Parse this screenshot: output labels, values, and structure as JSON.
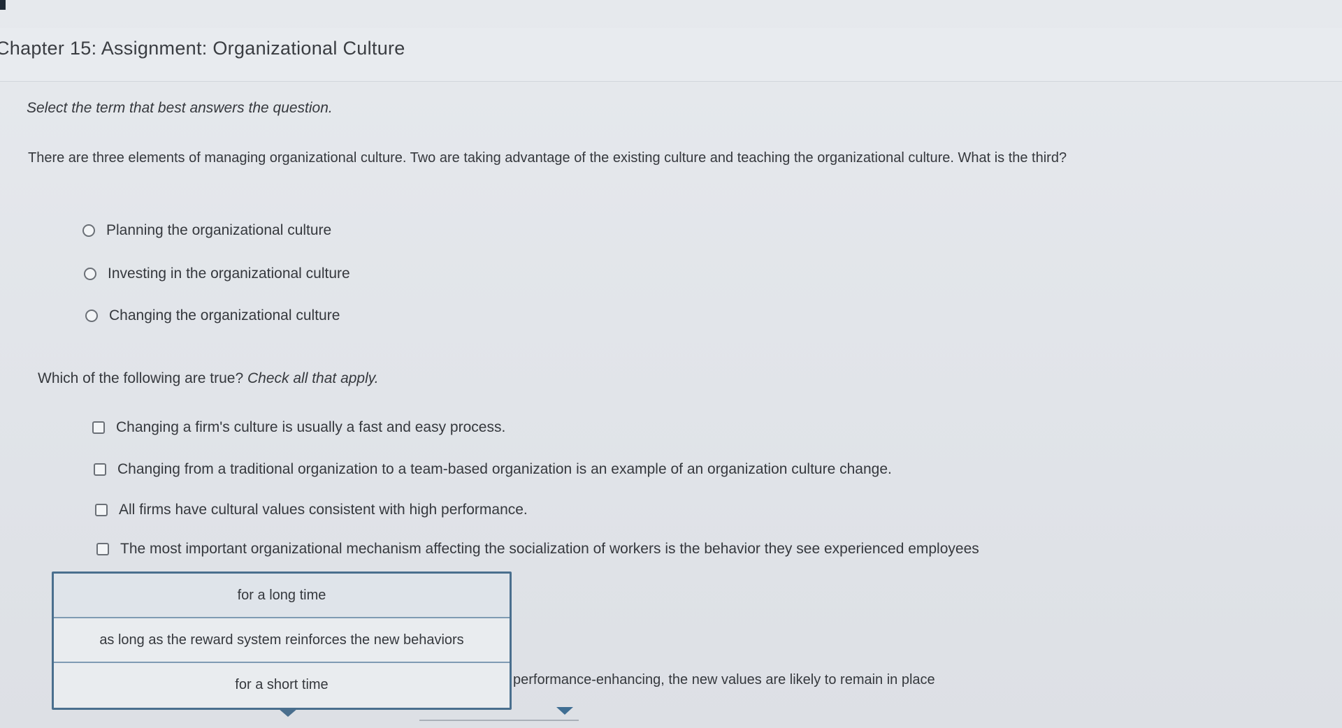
{
  "header": {
    "title": "Chapter 15: Assignment: Organizational Culture"
  },
  "question1": {
    "instruction": "Select the term that best answers the question.",
    "prompt": "There are three elements of managing organizational culture. Two are taking advantage of the existing culture and teaching the organizational culture. What is the third?",
    "options": [
      "Planning the organizational culture",
      "Investing in the organizational culture",
      "Changing the organizational culture"
    ]
  },
  "question2": {
    "prompt": "Which of the following are true?",
    "prompt_emphasis": "Check all that apply.",
    "options": [
      "Changing a firm's culture is usually a fast and easy process.",
      "Changing from a traditional organization to a team-based organization is an example of an organization culture change.",
      "All firms have cultural values consistent with high performance.",
      "The most important organizational mechanism affecting the socialization of workers is the behavior they see experienced employees"
    ],
    "partial_sentence_tail": "performance-enhancing, the new values are likely to remain in place",
    "dropdown_options": [
      "for a long time",
      "as long as the reward system reinforces the new behaviors",
      "for a short time"
    ]
  },
  "colors": {
    "dropdown_border": "#4a6f8e",
    "background": "#e3e6ea"
  }
}
